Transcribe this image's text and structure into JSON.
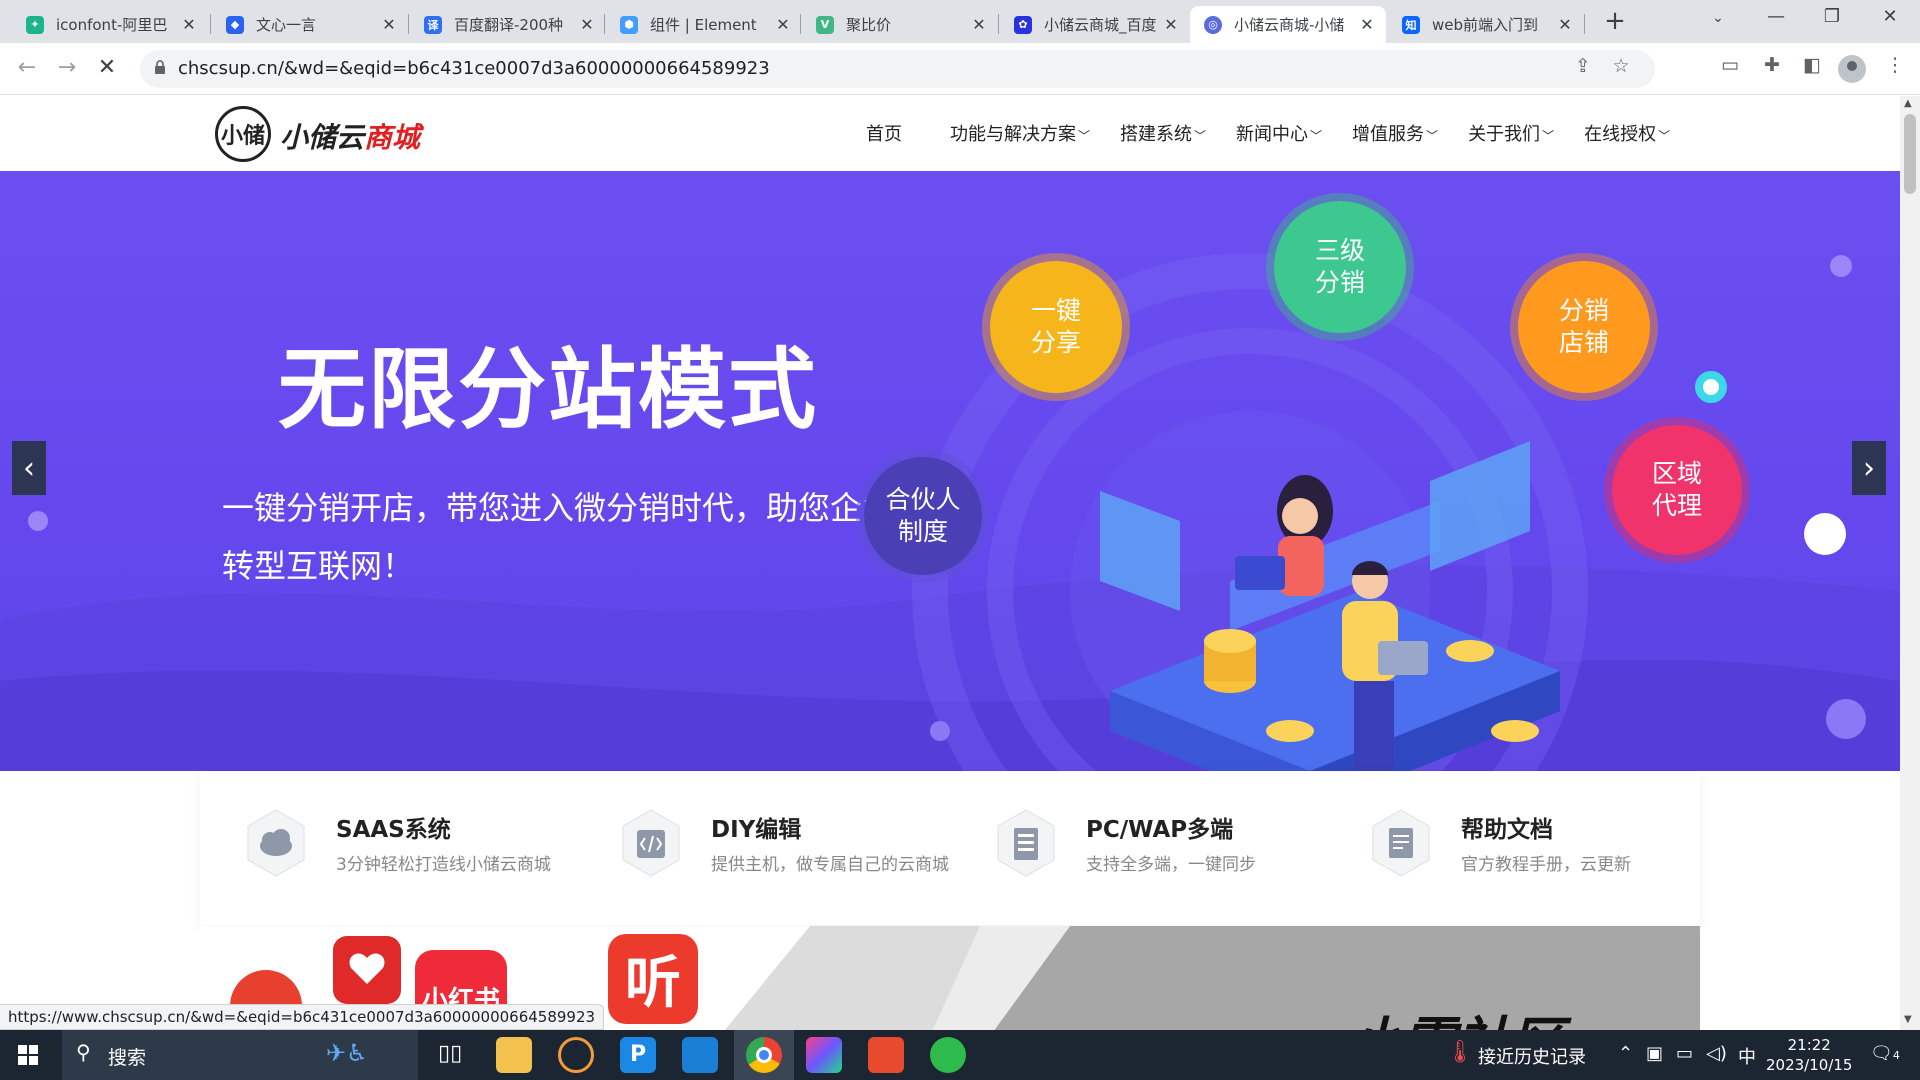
{
  "browser": {
    "tabs": [
      {
        "title": "iconfont-阿里巴",
        "favicon": "iconfont-favicon",
        "color": "#1db38b"
      },
      {
        "title": "文心一言",
        "favicon": "wenxin-favicon",
        "color": "#2b63f0"
      },
      {
        "title": "百度翻译-200种",
        "favicon": "baidu-translate-favicon",
        "color": "#2f6ff5",
        "glyph": "译"
      },
      {
        "title": "组件 | Element",
        "favicon": "element-favicon",
        "color": "#409eff"
      },
      {
        "title": "聚比价",
        "favicon": "vue-favicon",
        "color": "#41b883"
      },
      {
        "title": "小储云商城_百度",
        "favicon": "baidu-paw-favicon",
        "color": "#2932e1"
      },
      {
        "title": "小储云商城-小储",
        "favicon": "chscsup-favicon",
        "color": "#5a6be0"
      },
      {
        "title": "web前端入门到",
        "favicon": "zhihu-favicon",
        "color": "#0a66ff",
        "glyph": "知"
      }
    ],
    "active_tab": 6,
    "url": "chscsup.cn/&wd=&eqid=b6c431ce0007d3a60000000664589923",
    "status_url": "https://www.chscsup.cn/&wd=&eqid=b6c431ce0007d3a60000000664589923"
  },
  "site": {
    "logo_small": "小储",
    "logo_black": "小储云",
    "logo_red": "商城",
    "nav": [
      {
        "label": "首页",
        "dropdown": false
      },
      {
        "label": "功能与解决方案",
        "dropdown": true
      },
      {
        "label": "搭建系统",
        "dropdown": true
      },
      {
        "label": "新闻中心",
        "dropdown": true
      },
      {
        "label": "增值服务",
        "dropdown": true
      },
      {
        "label": "关于我们",
        "dropdown": true
      },
      {
        "label": "在线授权",
        "dropdown": true
      }
    ]
  },
  "banner": {
    "headline": "无限分站模式",
    "subline": "一键分销开店，带您进入微分销时代，助您企业转型互联网！",
    "bubbles": [
      {
        "label": "一键\n分享",
        "color": "#f7b51c",
        "ring": "#f0a21a"
      },
      {
        "label": "三级\n分销",
        "color": "#3cc88e",
        "ring": "#3fb986"
      },
      {
        "label": "分销\n店铺",
        "color": "#ff9a1f",
        "ring": "#f28a1f"
      },
      {
        "label": "合伙人\n制度",
        "color": "#4a3fb5",
        "ring": "#5d4fd6"
      },
      {
        "label": "区域\n代理",
        "color": "#f0336b",
        "ring": "#e52c61"
      }
    ]
  },
  "features": [
    {
      "title": "SAAS系统",
      "desc": "3分钟轻松打造线小储云商城",
      "icon": "saas-cloud-icon"
    },
    {
      "title": "DIY编辑",
      "desc": "提供主机，做专属自己的云商城",
      "icon": "code-edit-icon"
    },
    {
      "title": "PC/WAP多端",
      "desc": "支持全多端，一键同步",
      "icon": "devices-icon"
    },
    {
      "title": "帮助文档",
      "desc": "官方教程手册，云更新",
      "icon": "document-icon"
    }
  ],
  "promo": {
    "badge": "小红书",
    "listen": "听",
    "community": "小雷社区"
  },
  "taskbar": {
    "search": "搜索",
    "weather_text": "接近历史记录",
    "ime": "中",
    "time": "21:22",
    "date": "2023/10/15",
    "notifications": "4"
  }
}
